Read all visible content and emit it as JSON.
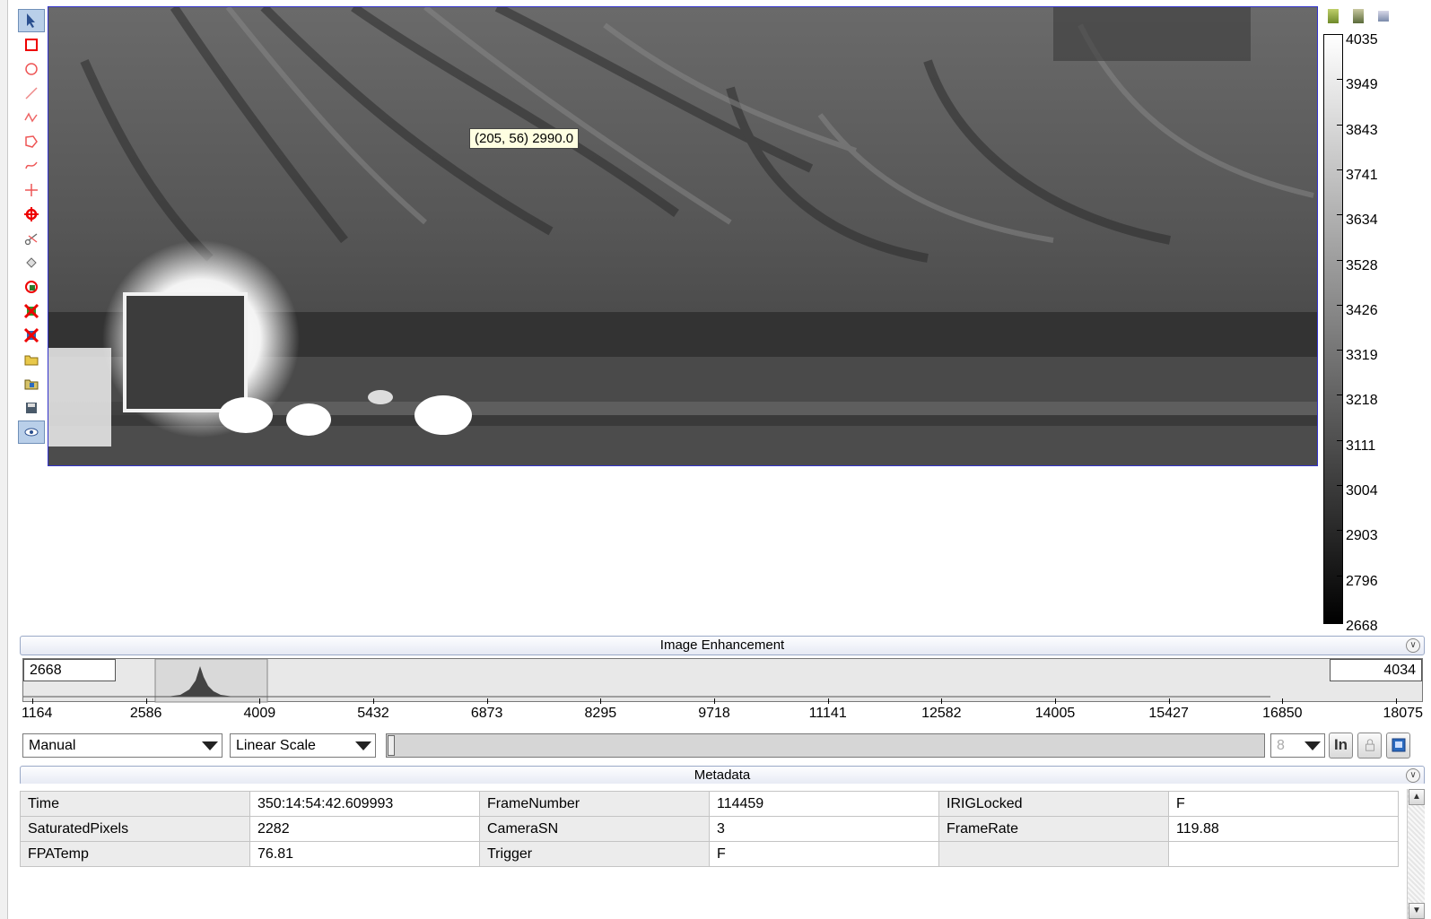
{
  "viewer": {
    "tooltip": "(205, 56) 2990.0"
  },
  "colorbar": {
    "ticks": [
      "4035",
      "3949",
      "3843",
      "3741",
      "3634",
      "3528",
      "3426",
      "3319",
      "3218",
      "3111",
      "3004",
      "2903",
      "2796",
      "2668"
    ],
    "top_color": "#ffffff",
    "bottom_color": "#000000",
    "icons": [
      "palette-icon",
      "palette-icon",
      "palette-icon"
    ]
  },
  "toolbar": {
    "tools": [
      "pointer-icon",
      "rectangle-icon",
      "ellipse-icon",
      "line-icon",
      "polyline-icon",
      "polygon-icon",
      "freehand-icon",
      "crosshair-icon",
      "target-icon",
      "scissors-icon",
      "fill-icon",
      "rotate-icon",
      "delete-icon",
      "delete-all-icon",
      "open-folder-icon",
      "import-icon",
      "save-icon",
      "eye-icon"
    ]
  },
  "enhancement": {
    "title": "Image Enhancement",
    "min_value": "2668",
    "max_value": "4034",
    "axis_ticks": [
      "1164",
      "2586",
      "4009",
      "5432",
      "6873",
      "8295",
      "9718",
      "11141",
      "12582",
      "14005",
      "15427",
      "16850",
      "18075"
    ],
    "mode": "Manual",
    "scale": "Linear Scale",
    "bits": "8",
    "in_label": "In"
  },
  "metadata": {
    "title": "Metadata",
    "rows": [
      [
        [
          "Time",
          "350:14:54:42.609993"
        ],
        [
          "FrameNumber",
          "114459"
        ],
        [
          "IRIGLocked",
          "F"
        ]
      ],
      [
        [
          "SaturatedPixels",
          "2282"
        ],
        [
          "CameraSN",
          "3"
        ],
        [
          "FrameRate",
          "119.88"
        ]
      ],
      [
        [
          "FPATemp",
          "76.81"
        ],
        [
          "Trigger",
          "F"
        ],
        [
          "",
          ""
        ]
      ]
    ]
  }
}
